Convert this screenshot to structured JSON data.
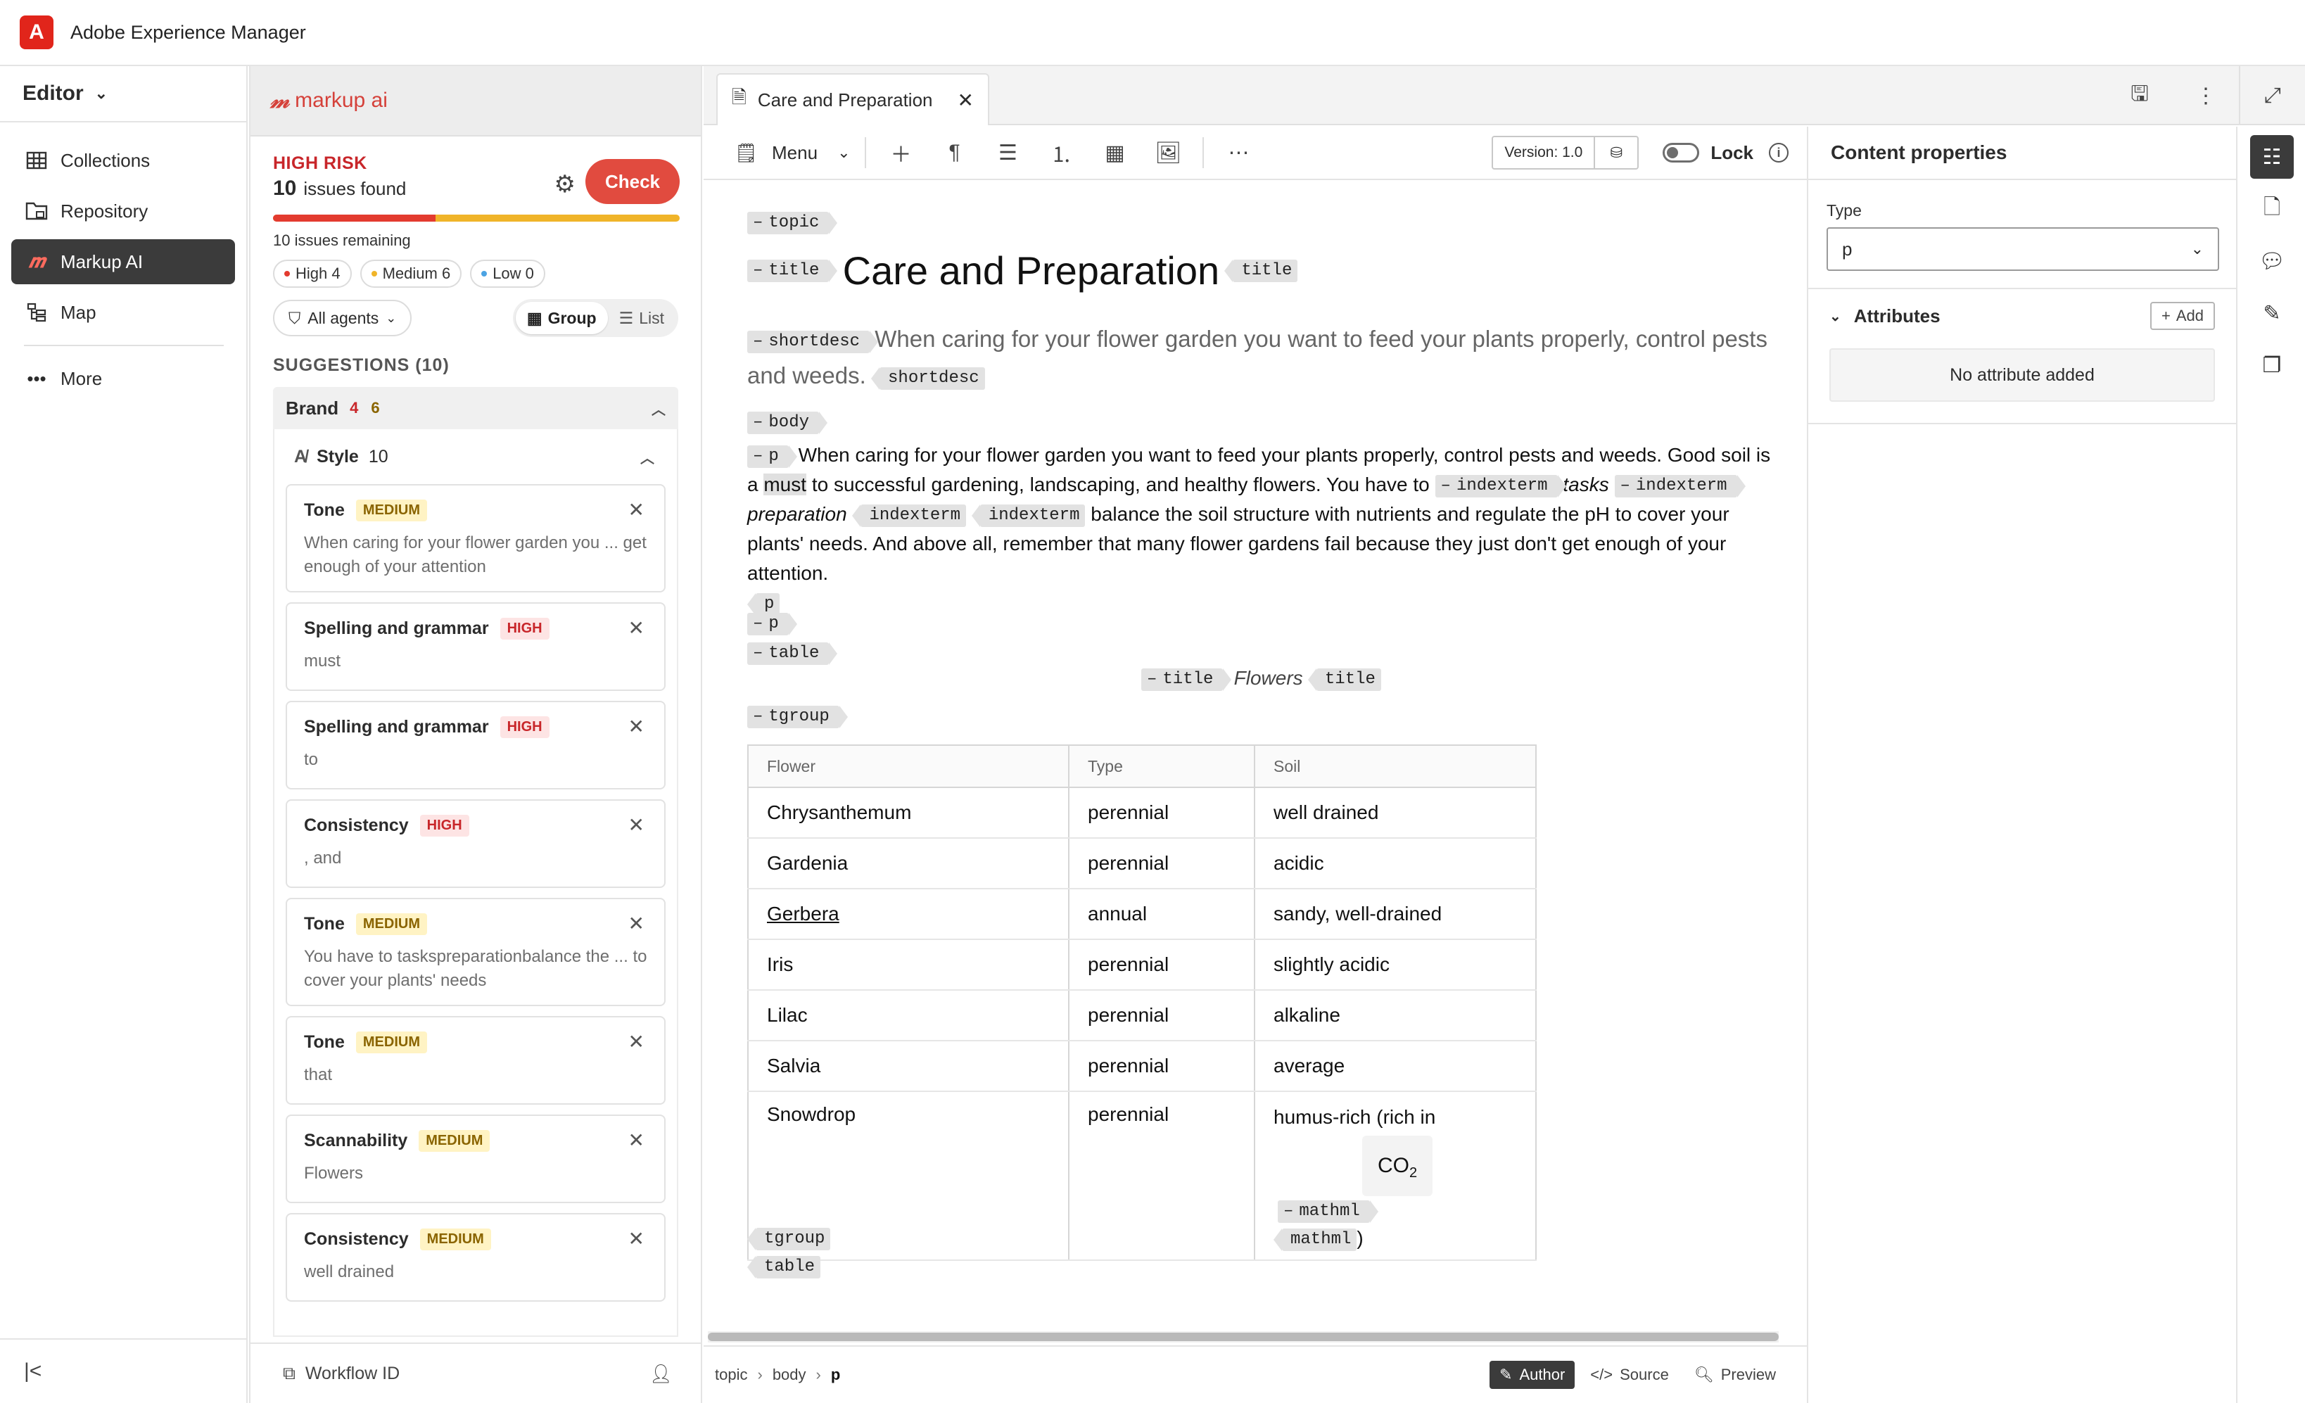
{
  "app": {
    "title": "Adobe Experience Manager",
    "logo_letter": "A",
    "brand_color": "#e1251b"
  },
  "leftnav": {
    "editor_label": "Editor",
    "items": [
      {
        "label": "Collections",
        "icon": "grid-icon"
      },
      {
        "label": "Repository",
        "icon": "folder-icon"
      },
      {
        "label": "Markup AI",
        "icon": "markup-ai-icon",
        "active": true
      },
      {
        "label": "Map",
        "icon": "map-icon"
      }
    ],
    "more_label": "More"
  },
  "markup": {
    "logo_text": "markup ai",
    "risk_label": "HIGH RISK",
    "issues_count": "10",
    "issues_label": "issues found",
    "check_label": "Check",
    "progress_high_fraction": 0.4,
    "remaining_text": "10 issues remaining",
    "chips": [
      {
        "label": "High 4",
        "color": "#e33b2f"
      },
      {
        "label": "Medium 6",
        "color": "#f0b429"
      },
      {
        "label": "Low 0",
        "color": "#4ba3e3"
      }
    ],
    "agents_label": "All agents",
    "group_label": "Group",
    "list_label": "List",
    "suggestions_heading": "SUGGESTIONS (10)",
    "brand_label": "Brand",
    "brand_high": "4",
    "brand_medium": "6",
    "style_label": "Style",
    "style_count": "10",
    "cards": [
      {
        "title": "Tone",
        "severity": "MEDIUM",
        "text": "When caring for your flower garden you ... get enough of your attention"
      },
      {
        "title": "Spelling and grammar",
        "severity": "HIGH",
        "text": "must"
      },
      {
        "title": "Spelling and grammar",
        "severity": "HIGH",
        "text": "to"
      },
      {
        "title": "Consistency",
        "severity": "HIGH",
        "text": ", and"
      },
      {
        "title": "Tone",
        "severity": "MEDIUM",
        "text": "You have to taskspreparationbalance the ... to cover your plants' needs"
      },
      {
        "title": "Tone",
        "severity": "MEDIUM",
        "text": "that"
      },
      {
        "title": "Scannability",
        "severity": "MEDIUM",
        "text": "Flowers"
      },
      {
        "title": "Consistency",
        "severity": "MEDIUM",
        "text": "well drained"
      }
    ],
    "workflow_label": "Workflow ID"
  },
  "tab": {
    "title": "Care and Preparation"
  },
  "toolbar": {
    "menu_label": "Menu",
    "version_label": "Version: 1.0",
    "lock_label": "Lock"
  },
  "doc": {
    "tags": {
      "topic": "topic",
      "title": "title",
      "shortdesc": "shortdesc",
      "body": "body",
      "p": "p",
      "indexterm": "indexterm",
      "table": "table",
      "tgroup": "tgroup",
      "mathml": "mathml"
    },
    "title": "Care and Preparation",
    "shortdesc": "When caring for your flower garden you want to feed your plants properly, control pests and weeds.",
    "para": {
      "part1": "When caring for your flower garden you want to feed your plants properly, control pests and weeds. Good soil is a",
      "must": "must",
      "part2": "to successful gardening, landscaping, and healthy flowers. You have to",
      "tasks": "tasks",
      "preparation": "preparation",
      "part3": "balance the soil structure with nutrients and regulate the pH to cover your plants' needs. And above all, remember that many flower gardens fail because they just don't get enough of your attention."
    },
    "table_title": "Flowers",
    "columns": [
      "Flower",
      "Type",
      "Soil"
    ],
    "rows": [
      [
        "Chrysanthemum",
        "perennial",
        "well drained"
      ],
      [
        "Gardenia",
        "perennial",
        "acidic"
      ],
      [
        "Gerbera",
        "annual",
        "sandy, well-drained"
      ],
      [
        "Iris",
        "perennial",
        "slightly acidic"
      ],
      [
        "Lilac",
        "perennial",
        "alkaline"
      ],
      [
        "Salvia",
        "perennial",
        "average"
      ],
      [
        "Snowdrop",
        "perennial",
        "humus-rich (rich in"
      ]
    ],
    "co2": "CO",
    "co2_sub": "2",
    "paren": ")"
  },
  "status": {
    "breadcrumbs": [
      "topic",
      "body",
      "p"
    ],
    "views": {
      "author": "Author",
      "source": "Source",
      "preview": "Preview"
    }
  },
  "props": {
    "heading": "Content properties",
    "type_label": "Type",
    "type_value": "p",
    "attributes_label": "Attributes",
    "add_label": "Add",
    "no_attr_text": "No attribute added"
  }
}
